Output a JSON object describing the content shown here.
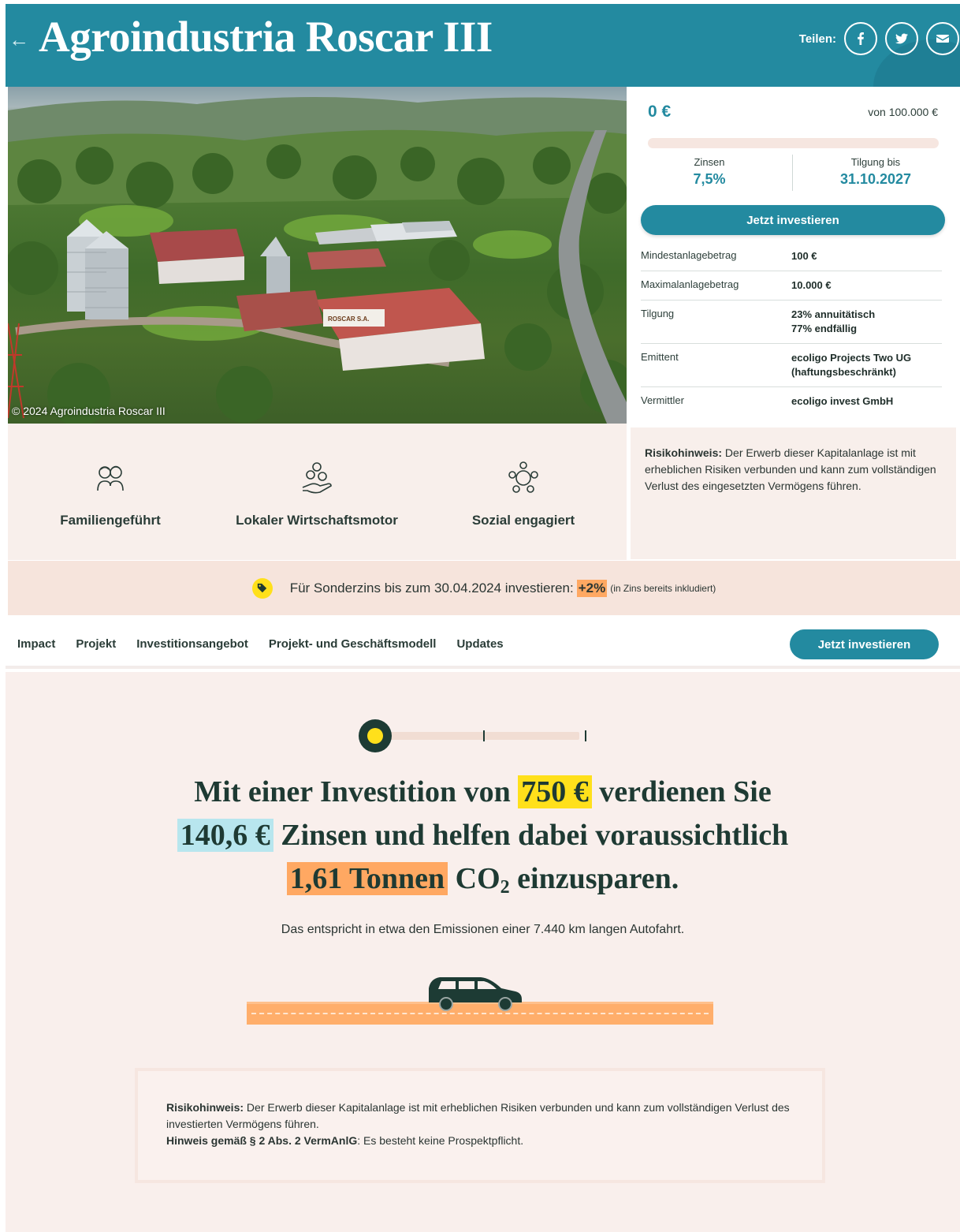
{
  "header": {
    "back_icon": "←",
    "title": "Agroindustria Roscar III",
    "share_label": "Teilen:",
    "share_icons": [
      "facebook-icon",
      "twitter-icon",
      "mail-icon"
    ]
  },
  "photo": {
    "credit": "© 2024 Agroindustria Roscar III",
    "sign_text": "ROSCAR S.A."
  },
  "invest": {
    "amount": "0 €",
    "goal": "von 100.000 €",
    "progress_fraction": 0,
    "interest_label": "Zinsen",
    "interest_value": "7,5%",
    "repayment_label": "Tilgung bis",
    "repayment_value": "31.10.2027",
    "button": "Jetzt investieren",
    "facts": [
      {
        "key": "Mindestanlagebetrag",
        "value": "100 €"
      },
      {
        "key": "Maximalanlagebetrag",
        "value": "10.000 €"
      },
      {
        "key": "Tilgung",
        "value": "23% annuitätisch\n77% endfällig"
      },
      {
        "key": "Emittent",
        "value": "ecoligo Projects Two UG (haftungsbeschränkt)"
      },
      {
        "key": "Vermittler",
        "value": "ecoligo invest GmbH"
      }
    ]
  },
  "features": [
    {
      "icon": "family-icon",
      "label": "Familiengeführt"
    },
    {
      "icon": "coins-hand-icon",
      "label": "Lokaler Wirtschaftsmotor"
    },
    {
      "icon": "community-icon",
      "label": "Sozial engagiert"
    }
  ],
  "risk_panel": {
    "bold": "Risikohinweis:",
    "text": " Der Erwerb dieser Kapitalanlage ist mit erheblichen Risiken verbunden und kann zum vollständigen Verlust des eingesetzten Vermögens führen."
  },
  "promo": {
    "icon": "tag-icon",
    "text": "Für Sonderzins bis zum 30.04.2024 investieren:",
    "bonus": "+2%",
    "note": "(in Zins bereits inkludiert)"
  },
  "nav": {
    "links": [
      "Impact",
      "Projekt",
      "Investitionsangebot",
      "Projekt- und Geschäftsmodell",
      "Updates"
    ],
    "button": "Jetzt investieren"
  },
  "impact": {
    "slider_position": 0,
    "line1_a": "Mit einer Investition von",
    "investment": "750 €",
    "line1_b": "verdienen Sie",
    "interest": "140,6 €",
    "line2": "Zinsen und helfen dabei voraussichtlich",
    "co2": "1,61 Tonnen",
    "co2_label": "CO",
    "co2_sub": "2",
    "line3": "einzusparen.",
    "equivalent": "Das entspricht in etwa den Emissionen einer 7.440 km langen Autofahrt.",
    "car_icon": "car-icon"
  },
  "bottom_risk": {
    "bold1": "Risikohinweis:",
    "text1": " Der Erwerb dieser Kapitalanlage ist mit erheblichen Risiken verbunden und kann zum vollständigen Verlust des investierten Vermögens führen.",
    "bold2": "Hinweis gemäß § 2 Abs. 2 VermAnlG",
    "text2": ": Es besteht keine Prospektpflicht."
  },
  "colors": {
    "teal": "#238aa0",
    "dark_green": "#1e3a33",
    "yellow": "#ffe01b",
    "light_blue": "#b8e6ee",
    "orange": "#ffa862",
    "blush": "#f8efeb"
  }
}
